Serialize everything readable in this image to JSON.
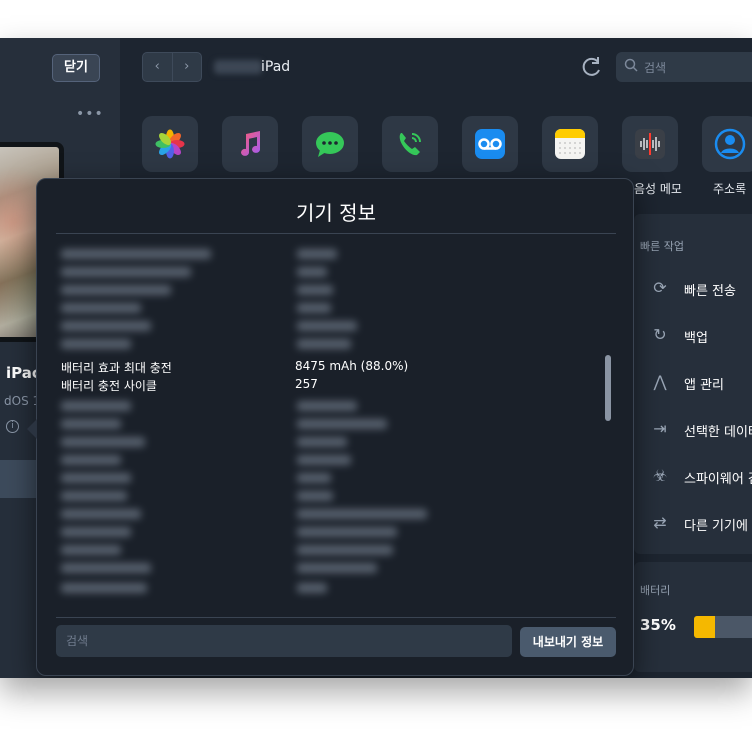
{
  "sidebar": {
    "close_label": "닫기",
    "more_label": "•••",
    "device_name": "iPac",
    "device_os": "dOS 1",
    "info_icon": "ⓘ"
  },
  "topbar": {
    "device_title": "iPad",
    "back_label": "‹",
    "forward_label": "›",
    "search_placeholder": "검색"
  },
  "apps": [
    {
      "icon": "photos-icon",
      "label": ""
    },
    {
      "icon": "music-icon",
      "label": ""
    },
    {
      "icon": "messages-icon",
      "label": ""
    },
    {
      "icon": "phone-icon",
      "label": ""
    },
    {
      "icon": "voicemail-icon",
      "label": ""
    },
    {
      "icon": "notes-icon",
      "label": ""
    },
    {
      "icon": "voice-memos-icon",
      "label": "음성 메모"
    },
    {
      "icon": "contacts-icon",
      "label": "주소록"
    }
  ],
  "quick_actions": {
    "title": "빠른 작업",
    "items": [
      {
        "icon": "quick-transfer-icon",
        "label": "빠른 전송"
      },
      {
        "icon": "backup-icon",
        "label": "백업"
      },
      {
        "icon": "app-manage-icon",
        "label": "앱 관리"
      },
      {
        "icon": "export-data-icon",
        "label": "선택한 데이터"
      },
      {
        "icon": "spyware-icon",
        "label": "스파이웨어 검"
      },
      {
        "icon": "transfer-device-icon",
        "label": "다른 기기에"
      }
    ]
  },
  "battery": {
    "title": "배터리",
    "percent_text": "35%",
    "level": 0.35,
    "fill_color": "#f5b800"
  },
  "modal": {
    "title": "기기 정보",
    "rows": [
      {
        "key": "배터리 효과 최대 충전",
        "value": "8475 mAh (88.0%)"
      },
      {
        "key": "배터리 충전 사이클",
        "value": "257"
      }
    ],
    "search_placeholder": "검색",
    "export_label": "내보내기 정보"
  },
  "colors": {
    "window_bg": "#1d2530",
    "panel_bg": "#262f3b",
    "accent_yellow": "#f5b800"
  }
}
